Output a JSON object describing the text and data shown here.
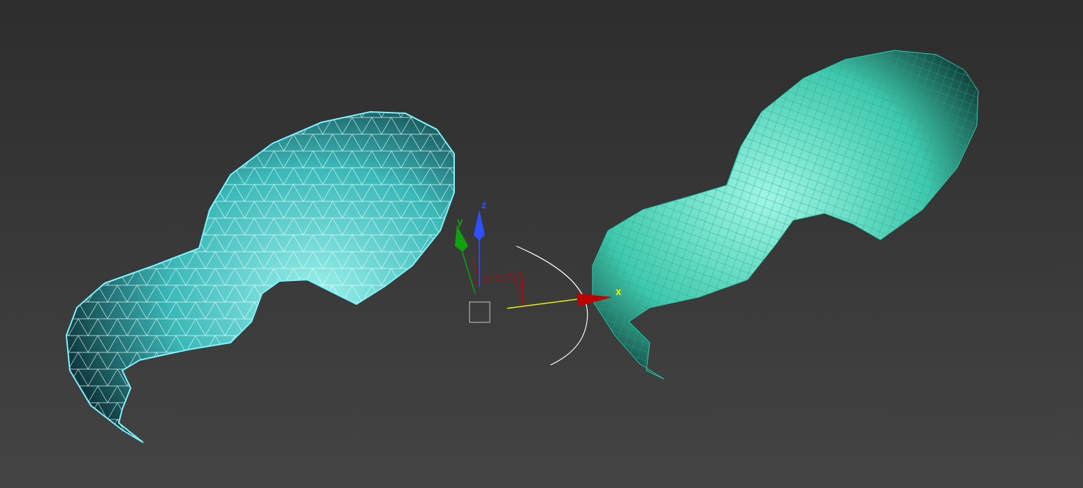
{
  "viewport": {
    "gizmo": {
      "axes": [
        {
          "label": "z",
          "color": "#3050ff",
          "active": false
        },
        {
          "label": "y",
          "color": "#10a010",
          "active": false
        },
        {
          "label": "x",
          "color": "#c00000",
          "active": true
        }
      ]
    }
  }
}
